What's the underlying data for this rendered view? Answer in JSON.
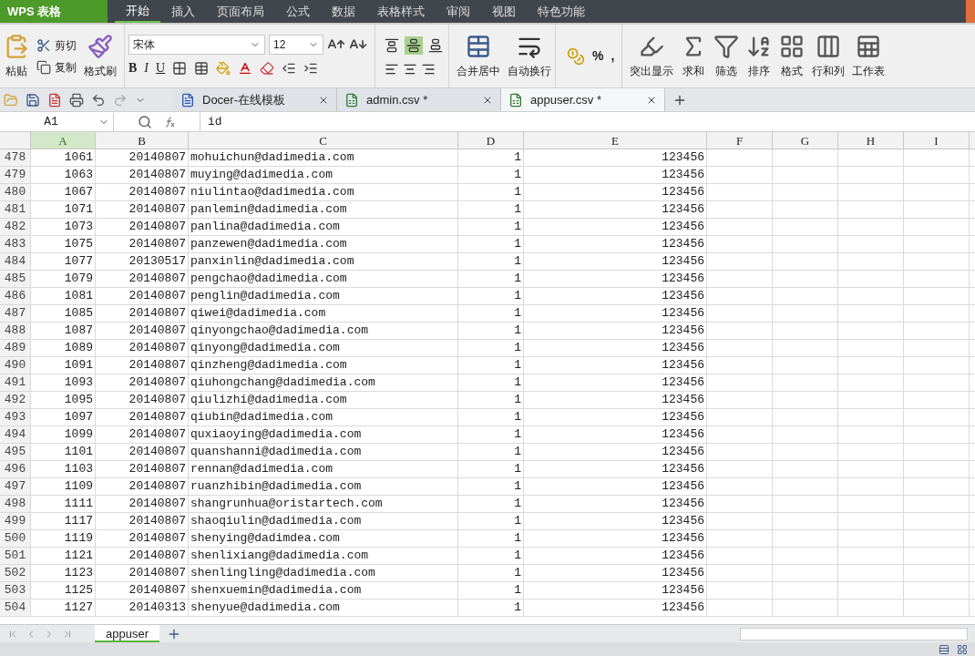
{
  "app_button": {
    "label": "WPS 表格"
  },
  "menu_tabs": [
    {
      "label": "开始",
      "selected": true
    },
    {
      "label": "插入",
      "selected": false
    },
    {
      "label": "页面布局",
      "selected": false
    },
    {
      "label": "公式",
      "selected": false
    },
    {
      "label": "数据",
      "selected": false
    },
    {
      "label": "表格样式",
      "selected": false
    },
    {
      "label": "审阅",
      "selected": false
    },
    {
      "label": "视图",
      "selected": false
    },
    {
      "label": "特色功能",
      "selected": false
    }
  ],
  "clipboard": {
    "paste": "粘贴",
    "cut": "剪切",
    "copy": "复制",
    "format_painter": "格式刷"
  },
  "font": {
    "name": "宋体",
    "size": "12",
    "styles": [
      "B",
      "I",
      "U"
    ]
  },
  "vertical_align": [
    {
      "selected": false
    },
    {
      "selected": true
    },
    {
      "selected": false
    }
  ],
  "merge": "合并居中",
  "wrap": "自动换行",
  "number_format": [
    "%",
    ","
  ],
  "tools": [
    "突出显示",
    "求和",
    "筛选",
    "排序",
    "格式",
    "行和列",
    "工作表"
  ],
  "doc_tabs": [
    {
      "kind": "docer",
      "label": "Docer-在线模板",
      "selected": false
    },
    {
      "kind": "sheet",
      "label": "admin.csv *",
      "selected": false
    },
    {
      "kind": "sheet",
      "label": "appuser.csv *",
      "selected": true
    }
  ],
  "name_box": "A1",
  "formula": "id",
  "columns": [
    {
      "label": "A",
      "selected": true
    },
    {
      "label": "B",
      "selected": false
    },
    {
      "label": "C",
      "selected": false
    },
    {
      "label": "D",
      "selected": false
    },
    {
      "label": "E",
      "selected": false
    },
    {
      "label": "F",
      "selected": false
    },
    {
      "label": "G",
      "selected": false
    },
    {
      "label": "H",
      "selected": false
    },
    {
      "label": "I",
      "selected": false
    }
  ],
  "rows": [
    [
      "478",
      "1061",
      "20140807",
      "mohuichun@dadimedia.com",
      "1",
      "123456"
    ],
    [
      "479",
      "1063",
      "20140807",
      "muying@dadimedia.com",
      "1",
      "123456"
    ],
    [
      "480",
      "1067",
      "20140807",
      "niulintao@dadimedia.com",
      "1",
      "123456"
    ],
    [
      "481",
      "1071",
      "20140807",
      "panlemin@dadimedia.com",
      "1",
      "123456"
    ],
    [
      "482",
      "1073",
      "20140807",
      "panlina@dadimedia.com",
      "1",
      "123456"
    ],
    [
      "483",
      "1075",
      "20140807",
      "panzewen@dadimedia.com",
      "1",
      "123456"
    ],
    [
      "484",
      "1077",
      "20130517",
      "panxinlin@dadimedia.com",
      "1",
      "123456"
    ],
    [
      "485",
      "1079",
      "20140807",
      "pengchao@dadimedia.com",
      "1",
      "123456"
    ],
    [
      "486",
      "1081",
      "20140807",
      "penglin@dadimedia.com",
      "1",
      "123456"
    ],
    [
      "487",
      "1085",
      "20140807",
      "qiwei@dadimedia.com",
      "1",
      "123456"
    ],
    [
      "488",
      "1087",
      "20140807",
      "qinyongchao@dadimedia.com",
      "1",
      "123456"
    ],
    [
      "489",
      "1089",
      "20140807",
      "qinyong@dadimedia.com",
      "1",
      "123456"
    ],
    [
      "490",
      "1091",
      "20140807",
      "qinzheng@dadimedia.com",
      "1",
      "123456"
    ],
    [
      "491",
      "1093",
      "20140807",
      "qiuhongchang@dadimedia.com",
      "1",
      "123456"
    ],
    [
      "492",
      "1095",
      "20140807",
      "qiulizhi@dadimedia.com",
      "1",
      "123456"
    ],
    [
      "493",
      "1097",
      "20140807",
      "qiubin@dadimedia.com",
      "1",
      "123456"
    ],
    [
      "494",
      "1099",
      "20140807",
      "quxiaoying@dadimedia.com",
      "1",
      "123456"
    ],
    [
      "495",
      "1101",
      "20140807",
      "quanshanni@dadimedia.com",
      "1",
      "123456"
    ],
    [
      "496",
      "1103",
      "20140807",
      "rennan@dadimedia.com",
      "1",
      "123456"
    ],
    [
      "497",
      "1109",
      "20140807",
      "ruanzhibin@dadimedia.com",
      "1",
      "123456"
    ],
    [
      "498",
      "1111",
      "20140807",
      "shangrunhua@oristartech.com",
      "1",
      "123456"
    ],
    [
      "499",
      "1117",
      "20140807",
      "shaoqiulin@dadimedia.com",
      "1",
      "123456"
    ],
    [
      "500",
      "1119",
      "20140807",
      "shenying@dadimdea.com",
      "1",
      "123456"
    ],
    [
      "501",
      "1121",
      "20140807",
      "shenlixiang@dadimedia.com",
      "1",
      "123456"
    ],
    [
      "502",
      "1123",
      "20140807",
      "shenlingling@dadimedia.com",
      "1",
      "123456"
    ],
    [
      "503",
      "1125",
      "20140807",
      "shenxuemin@dadimedia.com",
      "1",
      "123456"
    ],
    [
      "504",
      "1127",
      "20140313",
      "shenyue@dadimedia.com",
      "1",
      "123456"
    ]
  ],
  "sheet_tabs": [
    {
      "label": "appuser",
      "selected": true
    }
  ]
}
